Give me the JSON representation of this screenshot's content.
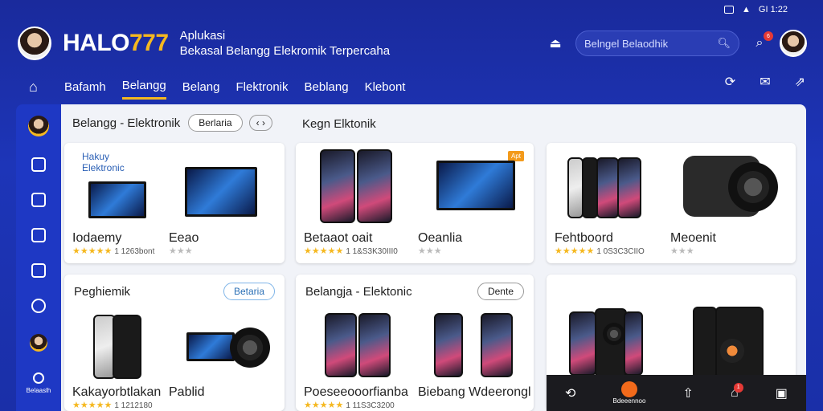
{
  "status": {
    "time": "GI 1:22"
  },
  "header": {
    "brand_a": "HALO",
    "brand_b": "777",
    "tagline_1": "Aplukasi",
    "tagline_2": "Bekasal Belangg Elekromik Terpercaha",
    "search_placeholder": "Belngel Belaodhik"
  },
  "nav": {
    "tabs": [
      "Bafamh",
      "Belangg",
      "Belang",
      "Flektronik",
      "Beblang",
      "Klebont"
    ],
    "active_index": 1
  },
  "sidebar": {
    "bottom_label": "Belaaslh"
  },
  "sections": {
    "row1_title": "Belangg - Elektronik",
    "row1_pill": "Berlaria",
    "row1_right_title": "Kegn Elktonik",
    "card4_title": "Peghiemik",
    "card4_pill": "Betaria",
    "card5_title": "Belangja - Elektonic",
    "card5_pill": "Dente"
  },
  "products": {
    "c1_promo_line1": "Hakuy",
    "c1_promo_line2": "Elektronic",
    "c1_p1_name": "Iodaemy",
    "c1_p1_count": "1 1263bont",
    "c1_p2_name": "Eeao",
    "c2_tag": "Apt",
    "c2_p1_name": "Betaaot oait",
    "c2_p1_count": "1 1&S3K30III0",
    "c2_p2_name": "Oeanlia",
    "c3_p1_name": "Fehtboord",
    "c3_p1_count": "1 0S3C3CIIO",
    "c3_p2_name": "Meoenit",
    "c4_p1_name": "Kakayorbtlakan",
    "c4_p1_count": "1 1212180",
    "c4_p2_name": "Pablid",
    "c5_p1_name": "Poeseeooorfianba",
    "c5_p1_count": "1 11S3C3200",
    "c5_p2_name": "Biebang Wdeerongl"
  },
  "bottombar": {
    "center_label": "Bdeeennoo",
    "badge": "1"
  }
}
